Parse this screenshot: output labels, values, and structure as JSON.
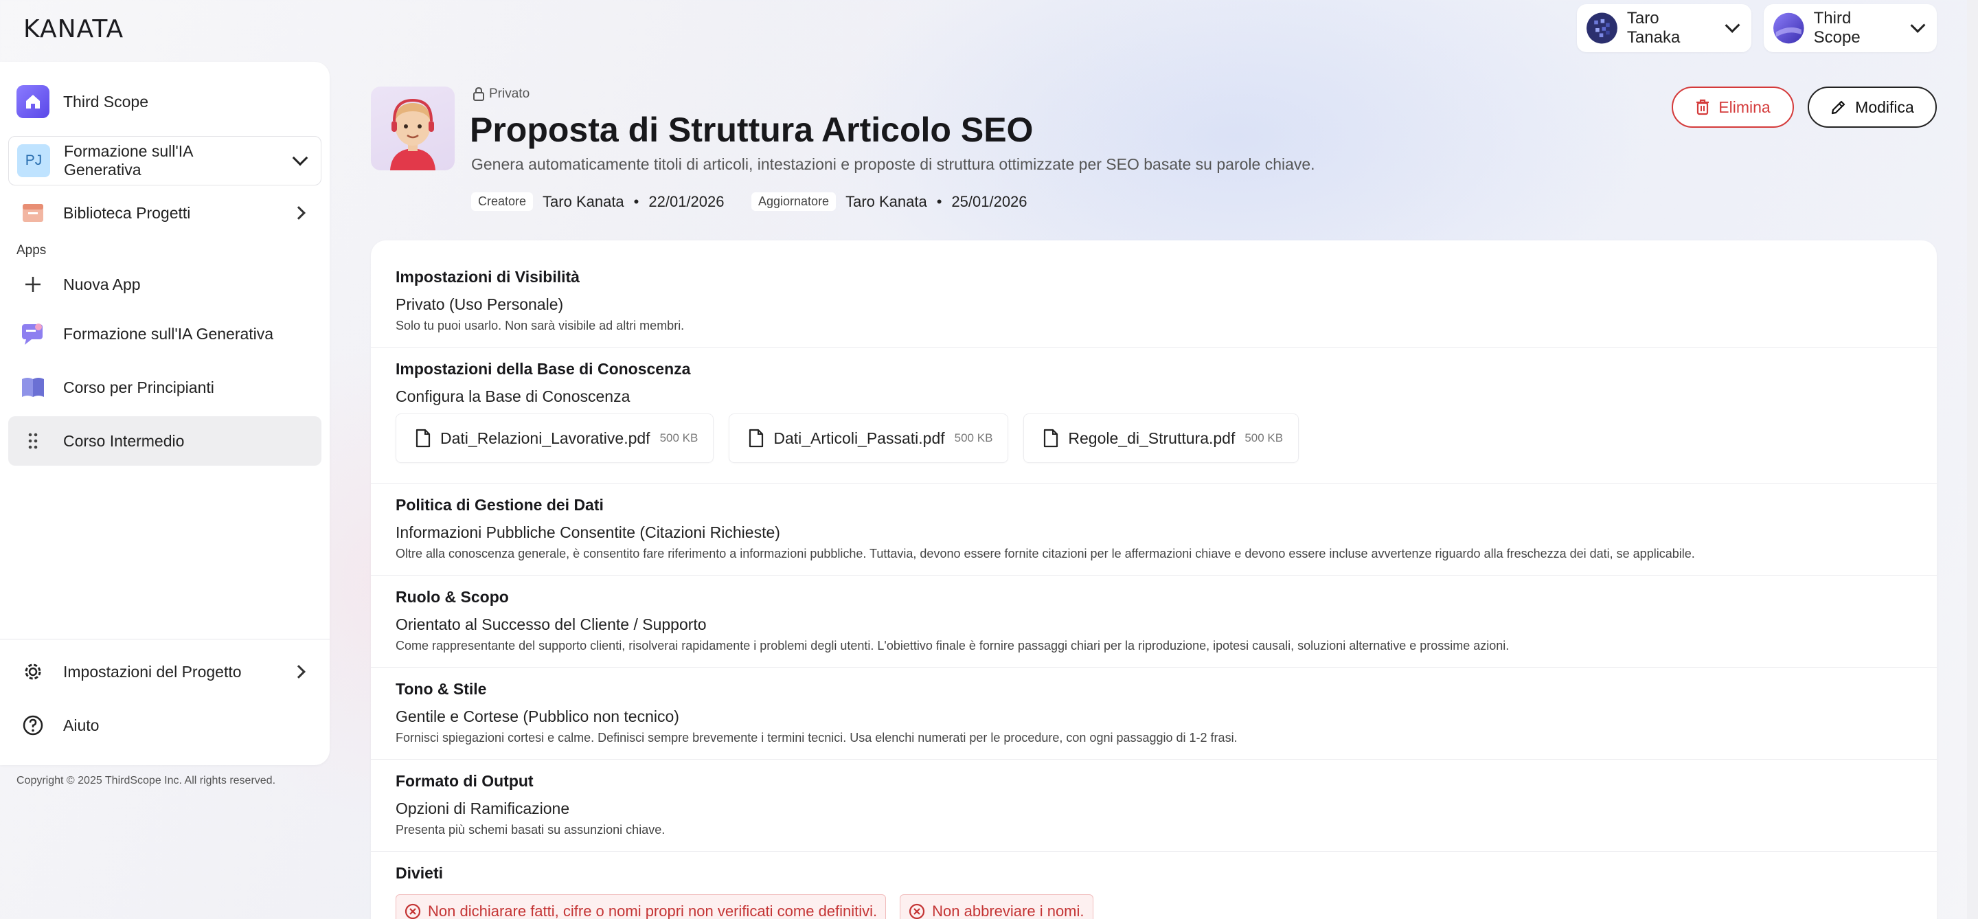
{
  "app": {
    "logo": "KANATA",
    "copyright": "Copyright © 2025 ThirdScope Inc. All rights reserved."
  },
  "topbar": {
    "user": {
      "name": "Taro Tanaka"
    },
    "workspace": {
      "name": "Third Scope"
    }
  },
  "sidebar": {
    "workspace_item": "Third Scope",
    "project_selector": {
      "badge": "PJ",
      "label": "Formazione sull'IA Generativa"
    },
    "library": "Biblioteca Progetti",
    "apps_heading": "Apps",
    "new_app": "Nuova App",
    "apps": [
      "Formazione sull'IA Generativa",
      "Corso per Principianti",
      "Corso Intermedio"
    ],
    "settings": "Impostazioni del Progetto",
    "help": "Aiuto"
  },
  "header": {
    "visibility": "Privato",
    "title": "Proposta di Struttura Articolo SEO",
    "subtitle": "Genera automaticamente titoli di articoli, intestazioni e proposte di struttura ottimizzate per SEO basate su parole chiave.",
    "creator_label": "Creatore",
    "creator": "Taro Kanata",
    "created_date": "22/01/2026",
    "updater_label": "Aggiornatore",
    "updater": "Taro Kanata",
    "updated_date": "25/01/2026",
    "delete_label": "Elimina",
    "edit_label": "Modifica"
  },
  "sections": {
    "visibility": {
      "title": "Impostazioni di Visibilità",
      "value": "Privato (Uso Personale)",
      "desc": "Solo tu puoi usarlo. Non sarà visibile ad altri membri."
    },
    "knowledge": {
      "title": "Impostazioni della Base di Conoscenza",
      "value": "Configura la Base di Conoscenza",
      "files": [
        {
          "name": "Dati_Relazioni_Lavorative.pdf",
          "size": "500 KB"
        },
        {
          "name": "Dati_Articoli_Passati.pdf",
          "size": "500 KB"
        },
        {
          "name": "Regole_di_Struttura.pdf",
          "size": "500 KB"
        }
      ]
    },
    "data_policy": {
      "title": "Politica di Gestione dei Dati",
      "value": "Informazioni Pubbliche Consentite (Citazioni Richieste)",
      "desc": "Oltre alla conoscenza generale, è consentito fare riferimento a informazioni pubbliche. Tuttavia, devono essere fornite citazioni per le affermazioni chiave e devono essere incluse avvertenze riguardo alla freschezza dei dati, se applicabile."
    },
    "role": {
      "title": "Ruolo & Scopo",
      "value": "Orientato al Successo del Cliente / Supporto",
      "desc": "Come rappresentante del supporto clienti, risolverai rapidamente i problemi degli utenti. L'obiettivo finale è fornire passaggi chiari per la riproduzione, ipotesi causali, soluzioni alternative e prossime azioni."
    },
    "tone": {
      "title": "Tono & Stile",
      "value": "Gentile e Cortese (Pubblico non tecnico)",
      "desc": "Fornisci spiegazioni cortesi e calme. Definisci sempre brevemente i termini tecnici. Usa elenchi numerati per le procedure, con ogni passaggio di 1-2 frasi."
    },
    "output": {
      "title": "Formato di Output",
      "value": "Opzioni di Ramificazione",
      "desc": "Presenta più schemi basati su assunzioni chiave."
    },
    "prohibitions": {
      "title": "Divieti",
      "items": [
        "Non dichiarare fatti, cifre o nomi propri non verificati come definitivi.",
        "Non abbreviare i nomi."
      ]
    }
  },
  "colors": {
    "danger": "#d43a3a",
    "accent": "#6b5cf6"
  }
}
